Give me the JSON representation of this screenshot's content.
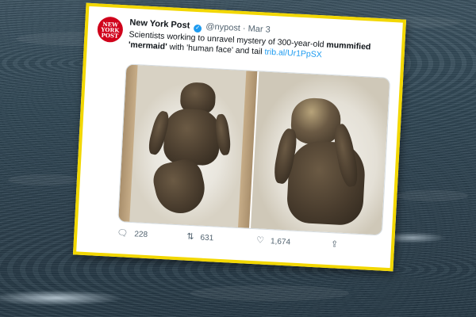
{
  "tweet": {
    "display_name": "New York Post",
    "handle": "@nypost",
    "separator": "·",
    "date": "Mar 3",
    "avatar_line1": "NEW",
    "avatar_line2": "YORK",
    "avatar_line3": "POST",
    "text_part1": "Scientists working to unravel mystery of 300-year-old ",
    "text_bold1": "mummified",
    "text_bold2": "'mermaid'",
    "text_part2": " with 'human face' and tail ",
    "link": "trib.al/Ur1PpSX",
    "replies": "228",
    "retweets": "631",
    "likes": "1,674",
    "icons": {
      "verified": "verified-badge-icon",
      "reply": "reply-icon",
      "retweet": "retweet-icon",
      "like": "heart-icon",
      "share": "share-icon"
    }
  },
  "colors": {
    "frame": "#f2d700",
    "link": "#1d9bf0",
    "brand_red": "#d0021b",
    "secondary_text": "#536471"
  }
}
